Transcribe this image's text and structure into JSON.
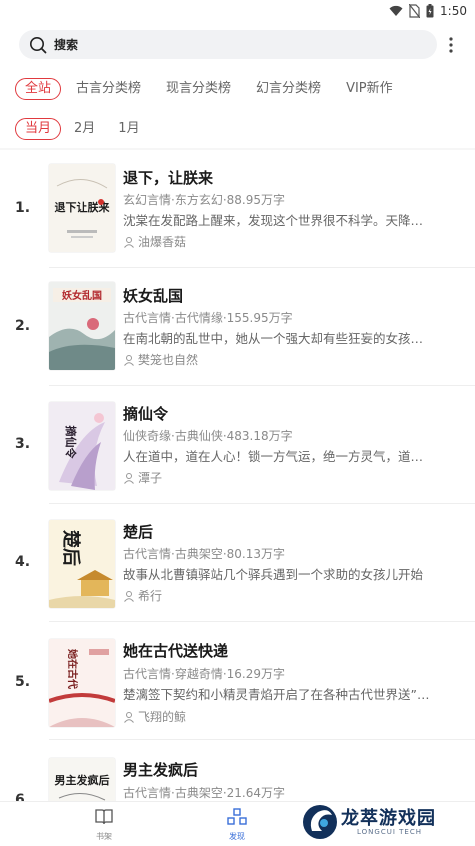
{
  "status_bar": {
    "time": "1:50",
    "icons": [
      "wifi-icon",
      "no-sim-icon",
      "battery-icon"
    ]
  },
  "search": {
    "label": "搜索"
  },
  "category_tabs": [
    {
      "label": "全站",
      "active": true
    },
    {
      "label": "古言分类榜",
      "active": false
    },
    {
      "label": "现言分类榜",
      "active": false
    },
    {
      "label": "幻言分类榜",
      "active": false
    },
    {
      "label": "VIP新作",
      "active": false
    }
  ],
  "month_tabs": [
    {
      "label": "当月",
      "active": true
    },
    {
      "label": "2月",
      "active": false
    },
    {
      "label": "1月",
      "active": false
    }
  ],
  "books": [
    {
      "rank": "1.",
      "title": "退下，让朕来",
      "meta": "玄幻言情·东方玄幻·88.95万字",
      "desc": "沈棠在发配路上醒来，发现这个世界很不科学。天降…",
      "author": "油爆香菇"
    },
    {
      "rank": "2.",
      "title": "妖女乱国",
      "meta": "古代言情·古代情缘·155.95万字",
      "desc": "在南北朝的乱世中，她从一个强大却有些狂妄的女孩…",
      "author": "樊笼也自然"
    },
    {
      "rank": "3.",
      "title": "摘仙令",
      "meta": "仙侠奇缘·古典仙侠·483.18万字",
      "desc": "人在道中，道在人心！锁一方气运，绝一方灵气，道…",
      "author": "潭子"
    },
    {
      "rank": "4.",
      "title": "楚后",
      "meta": "古代言情·古典架空·80.13万字",
      "desc": "故事从北曹镇驿站几个驿兵遇到一个求助的女孩儿开始",
      "author": "希行"
    },
    {
      "rank": "5.",
      "title": "她在古代送快递",
      "meta": "古代言情·穿越奇情·16.29万字",
      "desc": "楚漓签下契约和小精灵青焰开启了在各种古代世界送”…",
      "author": "飞翔的鲸"
    },
    {
      "rank": "6.",
      "title": "男主发疯后",
      "meta": "古代言情·古典架空·21.64万字",
      "desc": "",
      "author": ""
    }
  ],
  "cover_texts": [
    "退下让朕来",
    "妖女乱国",
    "摘仙令",
    "楚后",
    "她在古代",
    "男主发疯后"
  ],
  "bottom_nav": [
    {
      "label": "书架",
      "icon": "book-icon",
      "active": false
    },
    {
      "label": "发现",
      "icon": "discover-icon",
      "active": true
    }
  ],
  "watermark": {
    "title": "龙萃游戏园",
    "subtitle": "LONGCUI TECH"
  },
  "colors": {
    "accent": "#e0393e",
    "nav_active": "#3a6fd8",
    "list_bg": "#f6f6f6"
  }
}
